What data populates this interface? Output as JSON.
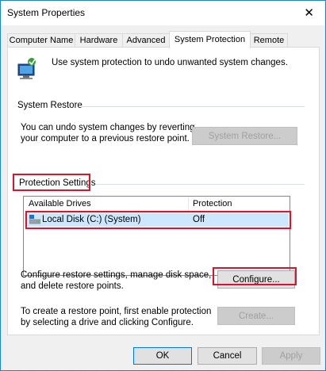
{
  "window": {
    "title": "System Properties"
  },
  "tabs": [
    {
      "label": "Computer Name"
    },
    {
      "label": "Hardware"
    },
    {
      "label": "Advanced"
    },
    {
      "label": "System Protection"
    },
    {
      "label": "Remote"
    }
  ],
  "intro_text": "Use system protection to undo unwanted system changes.",
  "system_restore": {
    "group_label": "System Restore",
    "description": "You can undo system changes by reverting your computer to a previous restore point.",
    "button_label": "System Restore..."
  },
  "protection_settings": {
    "group_label": "Protection Settings",
    "columns": [
      "Available Drives",
      "Protection"
    ],
    "rows": [
      {
        "drive": "Local Disk (C:) (System)",
        "protection": "Off"
      }
    ]
  },
  "configure": {
    "description": "Configure restore settings, manage disk space, and delete restore points.",
    "button_label": "Configure..."
  },
  "create": {
    "description": "To create a restore point, first enable protection by selecting a drive and clicking Configure.",
    "button_label": "Create..."
  },
  "dialog_buttons": {
    "ok": "OK",
    "cancel": "Cancel",
    "apply": "Apply"
  },
  "colors": {
    "highlight_box": "#d9142b",
    "window_border": "#1883d7",
    "selected_row": "#cce8ff"
  }
}
